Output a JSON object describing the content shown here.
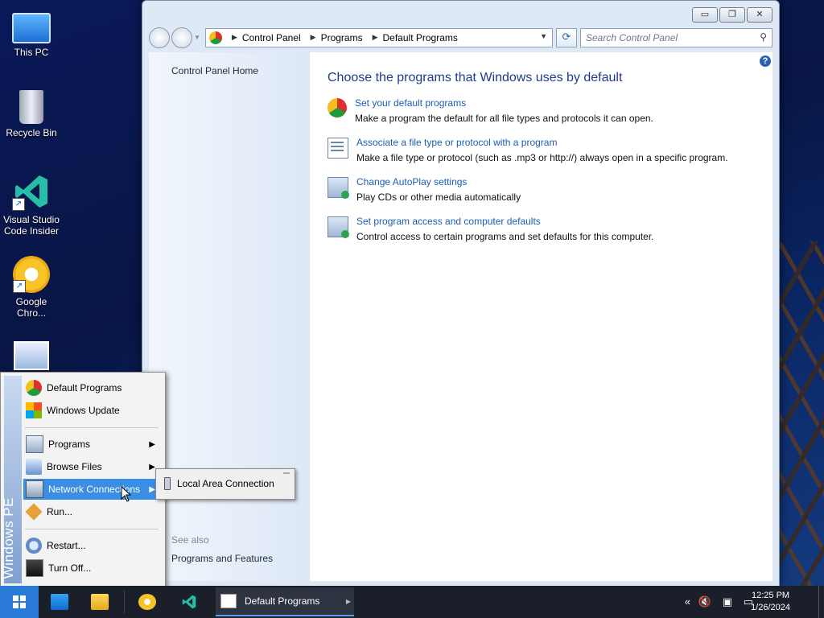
{
  "desktop": {
    "icons": [
      {
        "label": "This PC"
      },
      {
        "label": "Recycle Bin"
      },
      {
        "label": "Visual Studio Code Insider"
      },
      {
        "label": "Google Chro..."
      }
    ]
  },
  "window": {
    "buttons": {
      "minimize": "▭",
      "restore": "❐",
      "close": "✕"
    },
    "breadcrumb": [
      "Control Panel",
      "Programs",
      "Default Programs"
    ],
    "search_placeholder": "Search Control Panel",
    "left_pane": {
      "home": "Control Panel Home",
      "see_also": "See also",
      "programs_features": "Programs and Features"
    },
    "heading": "Choose the programs that Windows uses by default",
    "tasks": [
      {
        "link": "Set your default programs",
        "desc": "Make a program the default for all file types and protocols it can open.",
        "icon": "default-programs-icon"
      },
      {
        "link": "Associate a file type or protocol with a program",
        "desc": "Make a file type or protocol (such as .mp3 or http://) always open in a specific program.",
        "icon": "file-association-icon"
      },
      {
        "link": "Change AutoPlay settings",
        "desc": "Play CDs or other media automatically",
        "icon": "autoplay-icon"
      },
      {
        "link": "Set program access and computer defaults",
        "desc": "Control access to certain programs and set defaults for this computer.",
        "icon": "program-access-icon"
      }
    ]
  },
  "start_menu": {
    "band_text": "Windows PE",
    "items": [
      {
        "label": "Default Programs"
      },
      {
        "label": "Windows Update"
      },
      {
        "label": "Programs"
      },
      {
        "label": "Browse Files"
      },
      {
        "label": "Network Connections"
      },
      {
        "label": "Run..."
      },
      {
        "label": "Restart..."
      },
      {
        "label": "Turn Off..."
      }
    ],
    "submenu": {
      "item": "Local Area Connection"
    }
  },
  "taskbar": {
    "active_task": "Default Programs",
    "clock_time": "12:25 PM",
    "clock_date": "1/26/2024"
  },
  "colors": {
    "start_accent": "#2a7bd8",
    "menu_highlight": "#3a8ee6",
    "link": "#1b5db5",
    "heading": "#1e3c8a"
  }
}
